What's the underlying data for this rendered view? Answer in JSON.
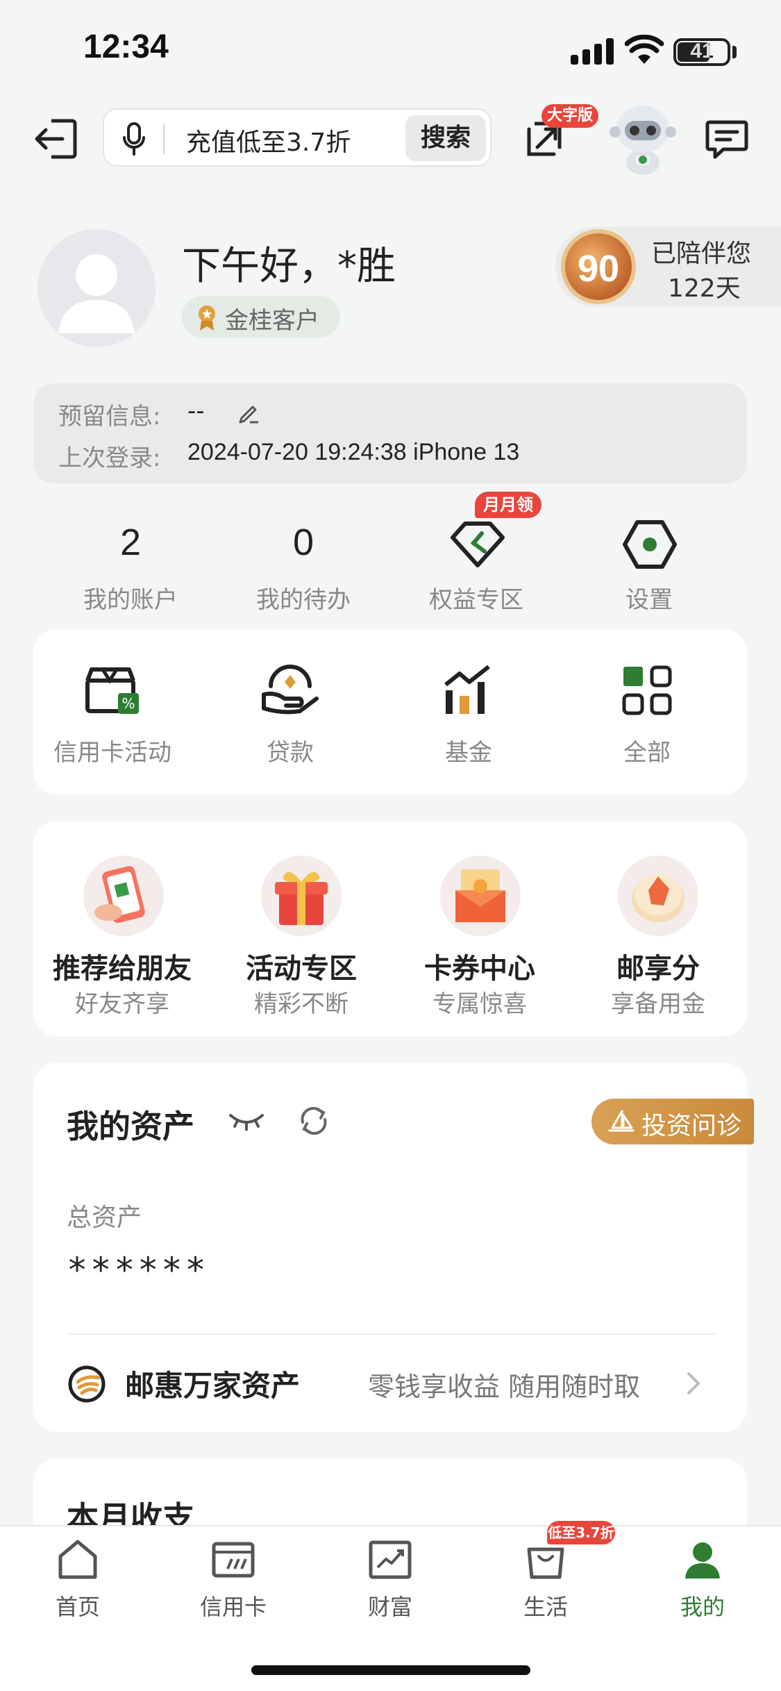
{
  "status": {
    "time": "12:34",
    "battery": "41"
  },
  "header": {
    "search_placeholder": "充值低至3.7折",
    "search_button": "搜索",
    "large_font_badge": "大字版"
  },
  "profile": {
    "greeting": "下午好，*胜",
    "level": "金桂客户",
    "medal_number": "90",
    "accompany_line1": "已陪伴您",
    "accompany_line2": "122天"
  },
  "info": {
    "reserved_label": "预留信息:",
    "reserved_value": "--",
    "last_login_label": "上次登录:",
    "last_login_value": "2024-07-20 19:24:38 iPhone 13"
  },
  "stats": {
    "accounts_count": "2",
    "accounts_label": "我的账户",
    "todo_count": "0",
    "todo_label": "我的待办",
    "rights_badge": "月月领",
    "rights_label": "权益专区",
    "settings_label": "设置"
  },
  "services": [
    {
      "label": "信用卡活动"
    },
    {
      "label": "贷款"
    },
    {
      "label": "基金"
    },
    {
      "label": "全部"
    }
  ],
  "promos": [
    {
      "title": "推荐给朋友",
      "subtitle": "好友齐享"
    },
    {
      "title": "活动专区",
      "subtitle": "精彩不断"
    },
    {
      "title": "卡券中心",
      "subtitle": "专属惊喜"
    },
    {
      "title": "邮享分",
      "subtitle": "享备用金"
    }
  ],
  "assets": {
    "title": "我的资产",
    "invest_button": "投资问诊",
    "total_label": "总资产",
    "total_value": "******",
    "product_name": "邮惠万家资产",
    "product_desc": "零钱享收益 随用随时取"
  },
  "monthly": {
    "title": "本月收支"
  },
  "tabbar": {
    "items": [
      {
        "label": "首页"
      },
      {
        "label": "信用卡"
      },
      {
        "label": "财富"
      },
      {
        "label": "生活"
      },
      {
        "label": "我的"
      }
    ],
    "life_badge": "低至3.7折",
    "active_color": "#2e7d32"
  }
}
